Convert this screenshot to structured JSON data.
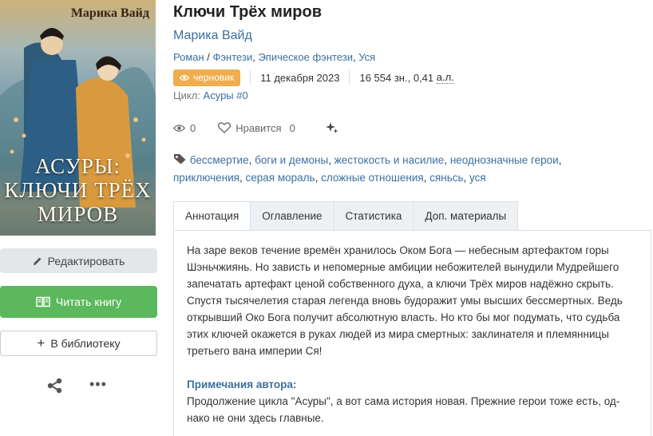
{
  "book": {
    "title": "Ключи Трёх миров",
    "author": "Марика Вайд",
    "genres": [
      "Роман",
      "Фэнтези",
      "Эпическое фэнтези",
      "Уся"
    ],
    "status_badge": "черновик",
    "date": "11 декабря 2023",
    "size_chars": "16 554 зн., 0,41",
    "size_unit": "а.л.",
    "cycle_label": "Цикл:",
    "cycle_name": "Асуры #0",
    "views": "0",
    "likes_label": "Нравится",
    "likes": "0",
    "tags": [
      "бессмертие",
      "боги и демоны",
      "жестокость и насилие",
      "неоднозначные герои",
      "приключения",
      "серая мораль",
      "сложные отношения",
      "сяньсь",
      "уся"
    ]
  },
  "cover": {
    "author_text": "Марика Вайд",
    "title_line1": "АСУРЫ:",
    "title_line2": "КЛЮЧИ ТРЁХ",
    "title_line3": "МИРОВ"
  },
  "actions": {
    "edit": "Редактировать",
    "read": "Читать книгу",
    "library": "В библиотеку"
  },
  "tabs": [
    "Аннотация",
    "Оглавление",
    "Статистика",
    "Доп. материалы"
  ],
  "annotation": "На заре веков течение времён хранилось Оком Бога — небесным артефактом горы Шэньчжиянь. Но зависть и непомерные амбиции небожителей вынудили Мудрейшего запечатать артефакт ценой собственного духа, а ключи Трёх миров надёжно скрыть. Спустя тысячелетия старая легенда вновь будоражит умы высших бессмертных. Ведь открывший Око Бога получит абсолютную власть. Но кто бы мог подумать, что судьба этих ключей окажется в руках людей из мира смертных: заклинателя и племянницы третьего вана империи Ся!",
  "author_notes": {
    "heading": "Примечания автора:",
    "text": "Продолжение цикла \"Асуры\", а вот сама история новая. Прежние герои тоже есть, од-нако не они здесь главные."
  },
  "colors": {
    "link": "#3c6fa0",
    "read_button": "#5cb85c",
    "badge": "#f0ad4e"
  }
}
